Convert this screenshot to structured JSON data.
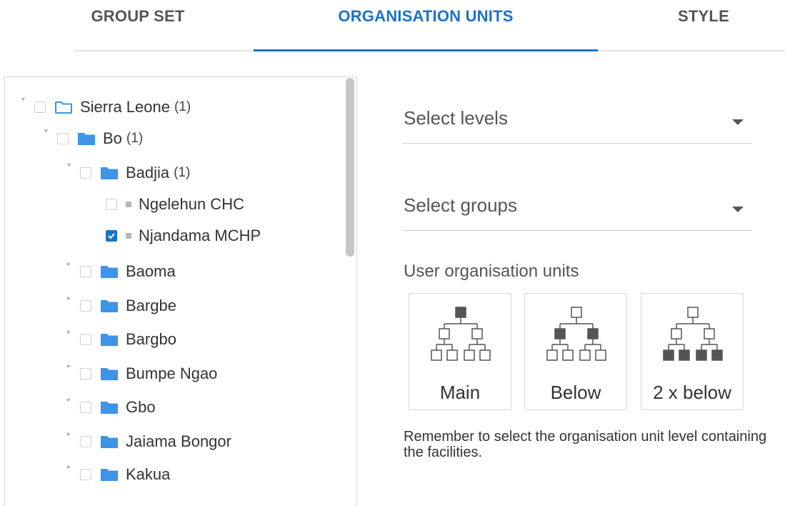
{
  "tabs": [
    {
      "label": "GROUP SET",
      "active": false
    },
    {
      "label": "ORGANISATION UNITS",
      "active": true
    },
    {
      "label": "STYLE",
      "active": false
    }
  ],
  "tree": [
    {
      "label": "Sierra Leone",
      "count": "(1)",
      "level": 0,
      "type": "folder-open",
      "expanded": true,
      "checked": false
    },
    {
      "label": "Bo",
      "count": "(1)",
      "level": 1,
      "type": "folder",
      "expanded": true,
      "checked": false
    },
    {
      "label": "Badjia",
      "count": "(1)",
      "level": 2,
      "type": "folder",
      "expanded": true,
      "checked": false
    },
    {
      "label": "Ngelehun CHC",
      "count": "",
      "level": 3,
      "type": "leaf",
      "checked": false
    },
    {
      "label": "Njandama MCHP",
      "count": "",
      "level": 3,
      "type": "leaf",
      "checked": true
    },
    {
      "label": "Baoma",
      "count": "",
      "level": 2,
      "type": "folder",
      "expanded": false,
      "checked": false
    },
    {
      "label": "Bargbe",
      "count": "",
      "level": 2,
      "type": "folder",
      "expanded": false,
      "checked": false
    },
    {
      "label": "Bargbo",
      "count": "",
      "level": 2,
      "type": "folder",
      "expanded": false,
      "checked": false
    },
    {
      "label": "Bumpe Ngao",
      "count": "",
      "level": 2,
      "type": "folder",
      "expanded": false,
      "checked": false
    },
    {
      "label": "Gbo",
      "count": "",
      "level": 2,
      "type": "folder",
      "expanded": false,
      "checked": false
    },
    {
      "label": "Jaiama Bongor",
      "count": "",
      "level": 2,
      "type": "folder",
      "expanded": false,
      "checked": false
    },
    {
      "label": "Kakua",
      "count": "",
      "level": 2,
      "type": "folder",
      "expanded": false,
      "checked": false
    }
  ],
  "select_levels": {
    "label": "Select levels"
  },
  "select_groups": {
    "label": "Select groups"
  },
  "user_org_units": {
    "title": "User organisation units",
    "options": [
      {
        "label": "Main",
        "icon": "hierarchy-main-icon"
      },
      {
        "label": "Below",
        "icon": "hierarchy-below-icon"
      },
      {
        "label": "2 x below",
        "icon": "hierarchy-2x-below-icon"
      }
    ]
  },
  "hint": "Remember to select the organisation unit level containing the facilities.",
  "colors": {
    "accent": "#1a73c8",
    "folder": "#3d94e8",
    "filled_node": "#555555"
  }
}
